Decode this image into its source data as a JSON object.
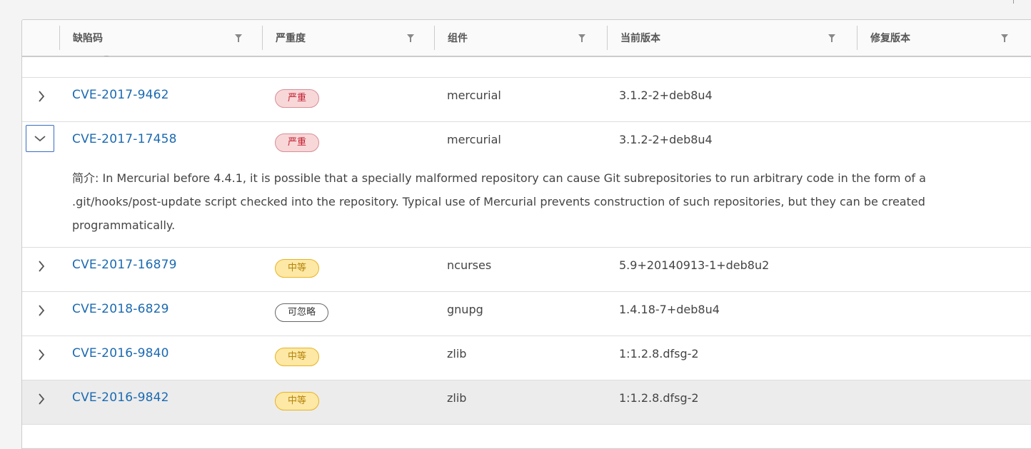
{
  "columns": [
    {
      "label": "缺陷码"
    },
    {
      "label": "严重度"
    },
    {
      "label": "组件"
    },
    {
      "label": "当前版本"
    },
    {
      "label": "修复版本"
    }
  ],
  "rows": [
    {
      "cve": "CVE-2017-9462",
      "severity": "严重",
      "severity_level": "critical",
      "component": "mercurial",
      "current_version": "3.1.2-2+deb8u4",
      "fixed_version": ""
    },
    {
      "cve": "CVE-2017-17458",
      "severity": "严重",
      "severity_level": "critical",
      "component": "mercurial",
      "current_version": "3.1.2-2+deb8u4",
      "fixed_version": "",
      "expanded": true,
      "description": "简介: In Mercurial before 4.4.1, it is possible that a specially malformed repository can cause Git subrepositories to run arbitrary code in the form of a .git/hooks/post-update script checked into the repository. Typical use of Mercurial prevents construction of such repositories, but they can be created programmatically."
    },
    {
      "cve": "CVE-2017-16879",
      "severity": "中等",
      "severity_level": "moderate",
      "component": "ncurses",
      "current_version": "5.9+20140913-1+deb8u2",
      "fixed_version": ""
    },
    {
      "cve": "CVE-2018-6829",
      "severity": "可忽略",
      "severity_level": "negligible",
      "component": "gnupg",
      "current_version": "1.4.18-7+deb8u4",
      "fixed_version": ""
    },
    {
      "cve": "CVE-2016-9840",
      "severity": "中等",
      "severity_level": "moderate",
      "component": "zlib",
      "current_version": "1:1.2.8.dfsg-2",
      "fixed_version": ""
    },
    {
      "cve": "CVE-2016-9842",
      "severity": "中等",
      "severity_level": "moderate",
      "component": "zlib",
      "current_version": "1:1.2.8.dfsg-2",
      "fixed_version": "",
      "highlighted": true
    }
  ],
  "colors": {
    "link": "#1b6ab1",
    "critical_bg": "#f8d7d9",
    "critical_text": "#c21d2d",
    "moderate_bg": "#fde8a5",
    "moderate_text": "#b5840a",
    "focus_border": "#3a6bc4"
  }
}
